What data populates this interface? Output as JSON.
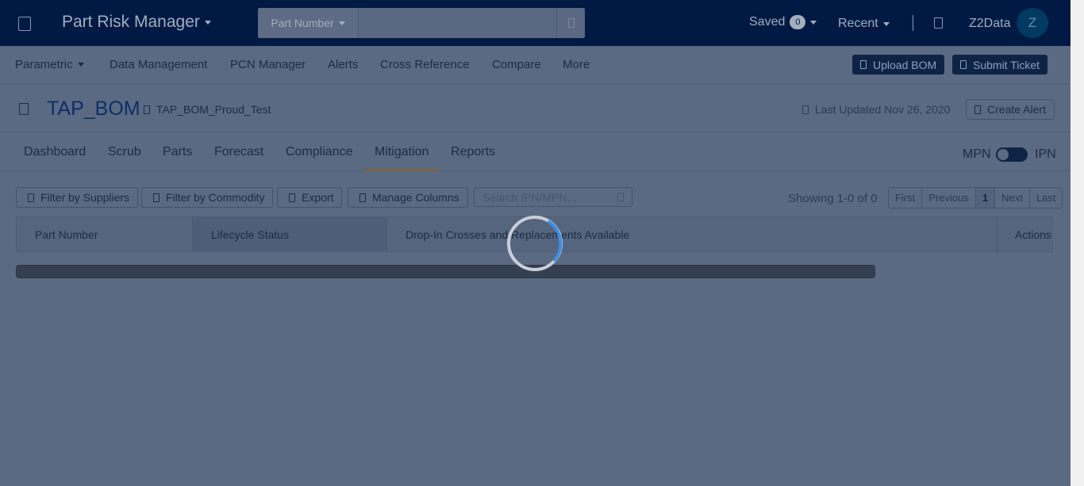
{
  "topbar": {
    "app_title": "Part Risk Manager",
    "search_type": "Part Number",
    "search_value": "",
    "saved_label": "Saved",
    "saved_count": "0",
    "recent_label": "Recent",
    "user_name": "Z2Data",
    "avatar_initial": "Z"
  },
  "nav": {
    "items": [
      "Parametric",
      "Data Management",
      "PCN Manager",
      "Alerts",
      "Cross Reference",
      "Compare",
      "More"
    ],
    "upload_bom": "Upload BOM",
    "submit_ticket": "Submit Ticket"
  },
  "bom": {
    "title": "TAP_BOM",
    "subtitle": "TAP_BOM_Proud_Test",
    "last_updated": "Last Updated Nov 26, 2020",
    "create_alert": "Create Alert"
  },
  "tabs": {
    "items": [
      "Dashboard",
      "Scrub",
      "Parts",
      "Forecast",
      "Compliance",
      "Mitigation",
      "Reports"
    ],
    "active": "Mitigation",
    "mpn": "MPN",
    "ipn": "IPN"
  },
  "toolbar": {
    "filter_suppliers": "Filter by Suppliers",
    "filter_commodity": "Filter by Commodity",
    "export": "Export",
    "manage_columns": "Manage Columns",
    "search_placeholder": "Search IPN/MPN...",
    "showing": "Showing 1-0 of 0",
    "pager": [
      "First",
      "Previous",
      "1",
      "Next",
      "Last"
    ]
  },
  "table": {
    "columns": [
      "Part Number",
      "Lifecycle Status",
      "Drop-In Crosses and Replacements Available",
      "Actions"
    ]
  },
  "colors": {
    "topbar_bg": "#001a44",
    "overlay_bg": "#5b6a83",
    "accent_dark": "#0e2447",
    "spinner_accent": "#3a8ee6"
  }
}
